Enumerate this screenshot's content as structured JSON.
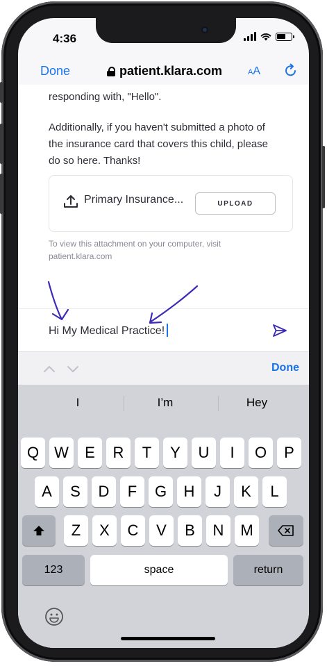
{
  "status": {
    "time": "4:36"
  },
  "nav": {
    "done_label": "Done",
    "url": "patient.klara.com",
    "text_size_small": "A",
    "text_size_large": "A"
  },
  "message": {
    "line_partial": "responding with, \"Hello\".",
    "paragraph_lines": [
      "Additionally, if you haven't submitted a photo of",
      "the insurance card that covers this child, please",
      "do so here. Thanks!"
    ]
  },
  "attachment": {
    "label": "Primary Insurance...",
    "button_label": "UPLOAD"
  },
  "note_lines": [
    "To view this attachment on your computer, visit",
    "patient.klara.com"
  ],
  "composer": {
    "value": "Hi My Medical Practice!"
  },
  "accessory": {
    "done_label": "Done"
  },
  "suggestions": [
    "I",
    "I’m",
    "Hey"
  ],
  "keyboard": {
    "row1": [
      "Q",
      "W",
      "E",
      "R",
      "T",
      "Y",
      "U",
      "I",
      "O",
      "P"
    ],
    "row2": [
      "A",
      "S",
      "D",
      "F",
      "G",
      "H",
      "J",
      "K",
      "L"
    ],
    "row3": [
      "Z",
      "X",
      "C",
      "V",
      "B",
      "N",
      "M"
    ],
    "numbers_label": "123",
    "space_label": "space",
    "return_label": "return"
  },
  "colors": {
    "accent": "#1a73e8",
    "annotation": "#3b2bb8",
    "frame": "#1b1b1d",
    "keyboard_bg": "#d1d3d9"
  }
}
